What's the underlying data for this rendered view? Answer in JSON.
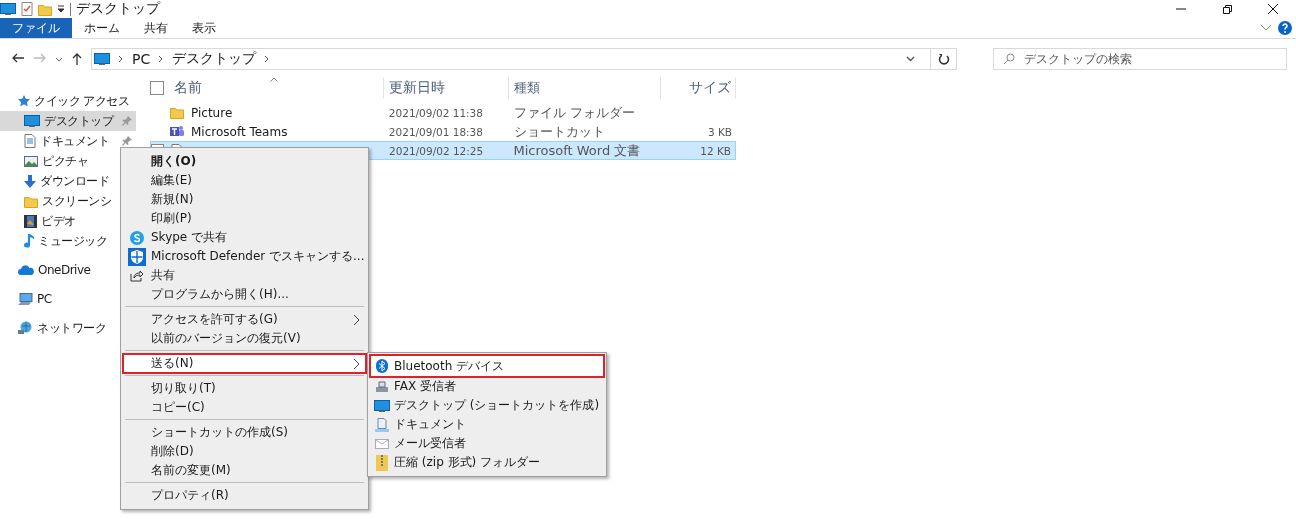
{
  "window": {
    "title": "デスクトップ"
  },
  "ribbon_tabs": [
    {
      "label": "ファイル",
      "selected": true
    },
    {
      "label": "ホーム",
      "selected": false
    },
    {
      "label": "共有",
      "selected": false
    },
    {
      "label": "表示",
      "selected": false
    }
  ],
  "address": {
    "crumbs": [
      "PC",
      "デスクトップ"
    ]
  },
  "search": {
    "placeholder": "デスクトップの検索"
  },
  "sidebar": {
    "items": [
      {
        "label": "クイック アクセス",
        "selected": false,
        "children": [
          {
            "label": "デスクトップ",
            "selected": true,
            "pinned": true
          },
          {
            "label": "ドキュメント",
            "selected": false,
            "pinned": true
          },
          {
            "label": "ピクチャ",
            "selected": false
          },
          {
            "label": "ダウンロード",
            "selected": false
          },
          {
            "label": "スクリーンシ",
            "selected": false
          },
          {
            "label": "ビデオ",
            "selected": false
          },
          {
            "label": "ミュージック",
            "selected": false
          }
        ]
      },
      {
        "label": "OneDrive",
        "selected": false
      },
      {
        "label": "PC",
        "selected": false
      },
      {
        "label": "ネットワーク",
        "selected": false
      }
    ]
  },
  "table": {
    "select_all": {
      "checked": false
    },
    "columns": [
      "名前",
      "更新日時",
      "種類",
      "サイズ"
    ],
    "rows": [
      {
        "name": "Picture",
        "modified": "2021/09/02 11:38",
        "type": "ファイル フォルダー",
        "size": "",
        "selected": false
      },
      {
        "name": "Microsoft Teams",
        "modified": "2021/09/01 18:38",
        "type": "ショートカット",
        "size": "3 KB",
        "selected": false
      },
      {
        "name": "",
        "modified": "2021/09/02 12:25",
        "type": "Microsoft Word 文書",
        "size": "12 KB",
        "selected": true
      }
    ]
  },
  "context_menu": {
    "items": [
      {
        "kind": "item",
        "label": "開く(O)",
        "bold": true,
        "highlighted": false
      },
      {
        "kind": "item",
        "label": "編集(E)",
        "bold": false,
        "highlighted": false
      },
      {
        "kind": "item",
        "label": "新規(N)",
        "bold": false,
        "highlighted": false
      },
      {
        "kind": "item",
        "label": "印刷(P)",
        "bold": false,
        "highlighted": false
      },
      {
        "kind": "item",
        "label": "Skype で共有",
        "bold": false,
        "highlighted": false
      },
      {
        "kind": "item",
        "label": "Microsoft Defender でスキャンする...",
        "bold": false,
        "highlighted": false
      },
      {
        "kind": "item",
        "label": "共有",
        "bold": false,
        "highlighted": false
      },
      {
        "kind": "item",
        "label": "プログラムから開く(H)...",
        "bold": false,
        "highlighted": false
      },
      {
        "kind": "separator"
      },
      {
        "kind": "submenu",
        "label": "アクセスを許可する(G)",
        "bold": false,
        "highlighted": false
      },
      {
        "kind": "item",
        "label": "以前のバージョンの復元(V)",
        "bold": false,
        "highlighted": false
      },
      {
        "kind": "separator"
      },
      {
        "kind": "submenu",
        "label": "送る(N)",
        "bold": false,
        "highlighted": true
      },
      {
        "kind": "separator"
      },
      {
        "kind": "item",
        "label": "切り取り(T)",
        "bold": false,
        "highlighted": false
      },
      {
        "kind": "item",
        "label": "コピー(C)",
        "bold": false,
        "highlighted": false
      },
      {
        "kind": "separator"
      },
      {
        "kind": "item",
        "label": "ショートカットの作成(S)",
        "bold": false,
        "highlighted": false
      },
      {
        "kind": "item",
        "label": "削除(D)",
        "bold": false,
        "highlighted": false
      },
      {
        "kind": "item",
        "label": "名前の変更(M)",
        "bold": false,
        "highlighted": false
      },
      {
        "kind": "separator"
      },
      {
        "kind": "item",
        "label": "プロパティ(R)",
        "bold": false,
        "highlighted": false
      }
    ]
  },
  "send_to_menu": {
    "items": [
      {
        "label": "Bluetooth デバイス",
        "highlighted": true
      },
      {
        "label": "FAX 受信者",
        "highlighted": false
      },
      {
        "label": "デスクトップ (ショートカットを作成)",
        "highlighted": false
      },
      {
        "label": "ドキュメント",
        "highlighted": false
      },
      {
        "label": "メール受信者",
        "highlighted": false
      },
      {
        "label": "圧縮 (zip 形式) フォルダー",
        "highlighted": false
      }
    ]
  }
}
